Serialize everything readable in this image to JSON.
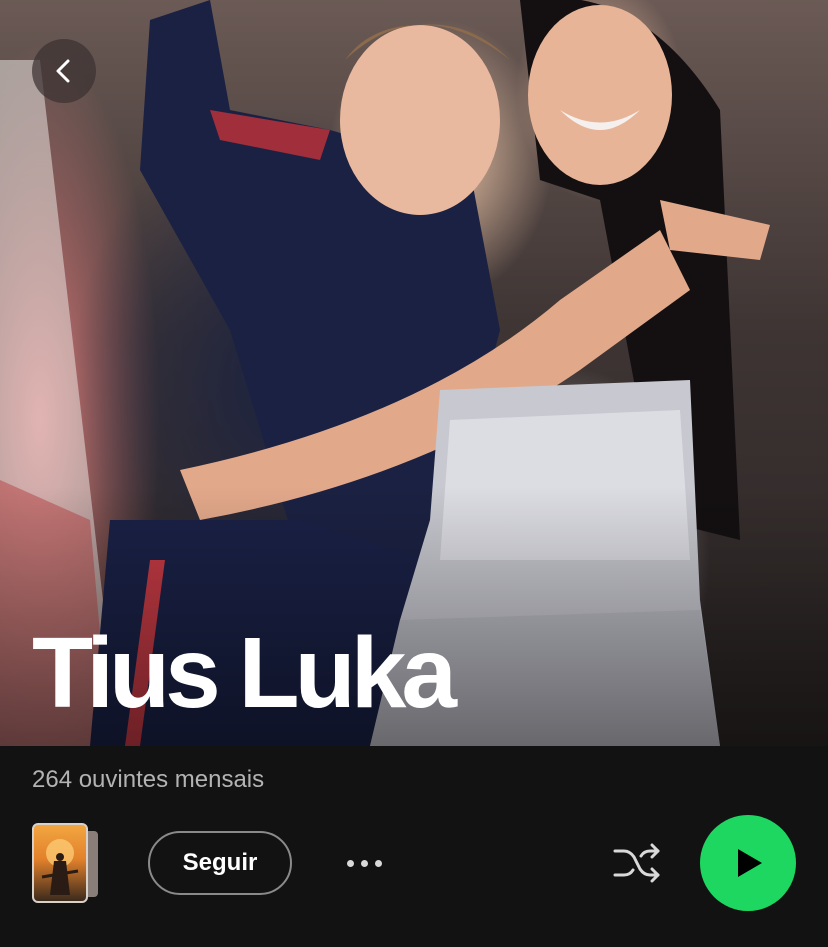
{
  "artist": {
    "name": "Tius Luka",
    "monthly_listeners": "264 ouvintes mensais"
  },
  "actions": {
    "follow_label": "Seguir",
    "more_icon": "more-dots-icon",
    "shuffle_icon": "shuffle-icon",
    "play_icon": "play-icon",
    "back_icon": "chevron-left-icon"
  },
  "colors": {
    "background": "#121212",
    "accent": "#1ed760",
    "secondary_text": "#b3b3b3"
  }
}
